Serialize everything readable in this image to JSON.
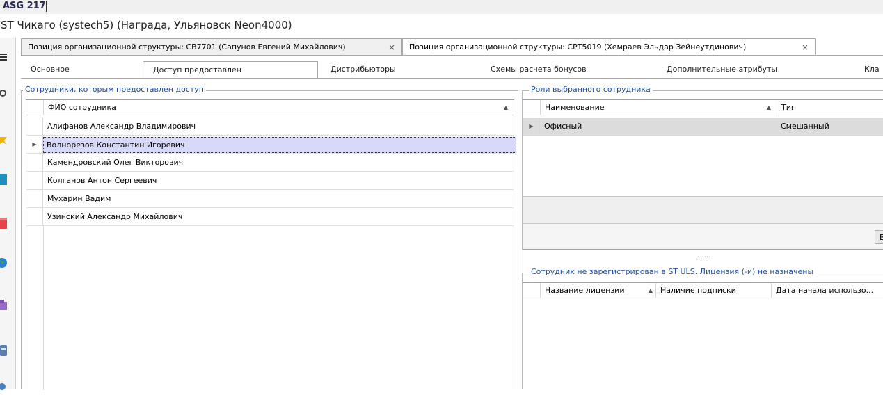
{
  "app_code": "ASG 217",
  "window_title": "ST Чикаго (systech5) (Награда, Ульяновск Neon4000)",
  "doc_tabs": [
    {
      "label": "Позиция организационной структуры: СВ7701 (Сапунов Евгений Михайлович)",
      "close": "×"
    },
    {
      "label": "Позиция организационной структуры: СРТ5019 (Хемраев Эльдар Зейнеутдинович)",
      "close": "×"
    }
  ],
  "sub_tabs": [
    "Основное",
    "Доступ предоставлен",
    "Дистрибьюторы",
    "Схемы расчета бонусов",
    "Дополнительные атрибуты",
    "Кла"
  ],
  "employees_group": {
    "title": "Сотрудники, которым предоставлен доступ",
    "column": "ФИО сотрудника",
    "rows": [
      "Алифанов Александр Владимирович",
      "Волнорезов Константин Игоревич",
      "Камендровский Олег Викторович",
      "Колганов Антон Сергеевич",
      "Мухарин Вадим",
      "Узинский Александр Михайлович"
    ],
    "selected_index": 1
  },
  "roles_group": {
    "title": "Роли выбранного сотрудника",
    "columns": [
      "Наименование",
      "Тип"
    ],
    "rows": [
      {
        "name": "Офисный",
        "type": "Смешанный"
      }
    ],
    "button_partial": "В"
  },
  "splitter": ".....",
  "license_group": {
    "title": "Сотрудник не зарегистрирован в ST ULS. Лицензия (-и) не назначены",
    "columns": [
      "Название лицензии",
      "Наличие подписки",
      "Дата начала использо..."
    ]
  },
  "colors": {
    "selected_row": "#d8d8f8",
    "selected_role_row": "#dcdcdc",
    "group_title": "#1e4fa0"
  },
  "rail_icons": [
    "menu-icon",
    "search-icon",
    "star-icon",
    "chart-icon",
    "calendar-icon",
    "globe-icon",
    "briefcase-icon",
    "document-icon",
    "settings-icon"
  ]
}
